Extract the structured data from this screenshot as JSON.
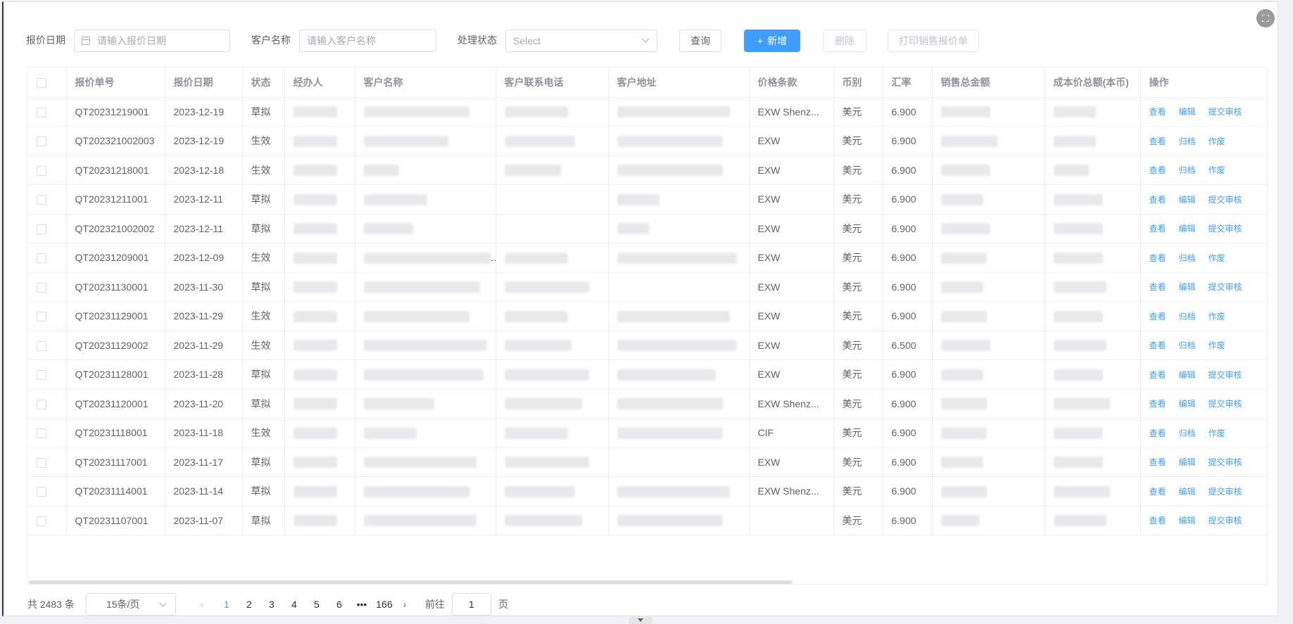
{
  "toolbar": {
    "date_label": "报价日期",
    "date_placeholder": "请输入报价日期",
    "customer_label": "客户名称",
    "customer_placeholder": "请输入客户名称",
    "status_label": "处理状态",
    "status_placeholder": "Select",
    "query_label": "查询",
    "add_label": "新增",
    "delete_label": "删除",
    "print_label": "打印销售报价单"
  },
  "table": {
    "columns": [
      "报价单号",
      "报价日期",
      "状态",
      "经办人",
      "客户名称",
      "客户联系电话",
      "客户地址",
      "价格条款",
      "币别",
      "汇率",
      "销售总金额",
      "成本价总额(本币)",
      "操作"
    ],
    "rows": [
      {
        "no": "QT20231219001",
        "date": "2023-12-19",
        "status": "草拟",
        "terms": "EXW Shenz...",
        "currency": "美元",
        "rate": "6.900",
        "ops": [
          "查看",
          "编辑",
          "提交审核"
        ]
      },
      {
        "no": "QT202321002003",
        "date": "2023-12-19",
        "status": "生效",
        "terms": "EXW",
        "currency": "美元",
        "rate": "6.900",
        "ops": [
          "查看",
          "归档",
          "作废"
        ]
      },
      {
        "no": "QT20231218001",
        "date": "2023-12-18",
        "status": "生效",
        "terms": "EXW",
        "currency": "美元",
        "rate": "6.900",
        "ops": [
          "查看",
          "归档",
          "作废"
        ]
      },
      {
        "no": "QT20231211001",
        "date": "2023-12-11",
        "status": "草拟",
        "terms": "EXW",
        "currency": "美元",
        "rate": "6.900",
        "ops": [
          "查看",
          "编辑",
          "提交审核"
        ]
      },
      {
        "no": "QT202321002002",
        "date": "2023-12-11",
        "status": "草拟",
        "terms": "EXW",
        "currency": "美元",
        "rate": "6.900",
        "ops": [
          "查看",
          "编辑",
          "提交审核"
        ]
      },
      {
        "no": "QT20231209001",
        "date": "2023-12-09",
        "status": "生效",
        "terms": "EXW",
        "currency": "美元",
        "rate": "6.900",
        "ops": [
          "查看",
          "归档",
          "作废"
        ]
      },
      {
        "no": "QT20231130001",
        "date": "2023-11-30",
        "status": "草拟",
        "terms": "EXW",
        "currency": "美元",
        "rate": "6.900",
        "ops": [
          "查看",
          "编辑",
          "提交审核"
        ]
      },
      {
        "no": "QT20231129001",
        "date": "2023-11-29",
        "status": "生效",
        "terms": "EXW",
        "currency": "美元",
        "rate": "6.900",
        "ops": [
          "查看",
          "归档",
          "作废"
        ]
      },
      {
        "no": "QT20231129002",
        "date": "2023-11-29",
        "status": "生效",
        "terms": "EXW",
        "currency": "美元",
        "rate": "6.500",
        "ops": [
          "查看",
          "归档",
          "作废"
        ]
      },
      {
        "no": "QT20231128001",
        "date": "2023-11-28",
        "status": "草拟",
        "terms": "EXW",
        "currency": "美元",
        "rate": "6.900",
        "ops": [
          "查看",
          "编辑",
          "提交审核"
        ]
      },
      {
        "no": "QT20231120001",
        "date": "2023-11-20",
        "status": "草拟",
        "terms": "EXW Shenz...",
        "currency": "美元",
        "rate": "6.900",
        "ops": [
          "查看",
          "编辑",
          "提交审核"
        ]
      },
      {
        "no": "QT20231118001",
        "date": "2023-11-18",
        "status": "生效",
        "terms": "CIF",
        "currency": "美元",
        "rate": "6.900",
        "ops": [
          "查看",
          "归档",
          "作废"
        ]
      },
      {
        "no": "QT20231117001",
        "date": "2023-11-17",
        "status": "草拟",
        "terms": "EXW",
        "currency": "美元",
        "rate": "6.900",
        "ops": [
          "查看",
          "编辑",
          "提交审核"
        ]
      },
      {
        "no": "QT20231114001",
        "date": "2023-11-14",
        "status": "草拟",
        "terms": "EXW Shenz...",
        "currency": "美元",
        "rate": "6.900",
        "ops": [
          "查看",
          "编辑",
          "提交审核"
        ]
      },
      {
        "no": "QT20231107001",
        "date": "2023-11-07",
        "status": "草拟",
        "terms": "",
        "currency": "美元",
        "rate": "6.900",
        "ops": [
          "查看",
          "编辑",
          "提交审核"
        ]
      }
    ]
  },
  "pagination": {
    "total": "共 2483 条",
    "page_size": "15条/页",
    "pages": [
      "1",
      "2",
      "3",
      "4",
      "5",
      "6"
    ],
    "ellipsis": "•••",
    "last_page": "166",
    "goto_label": "前往",
    "goto_value": "1",
    "page_suffix": "页",
    "prev_icon": "‹",
    "next_icon": "›"
  },
  "icons": {
    "fullscreen": "⛶",
    "plus": "+"
  },
  "colors": {
    "primary": "#409eff",
    "header_text": "#909399",
    "text": "#606266"
  }
}
